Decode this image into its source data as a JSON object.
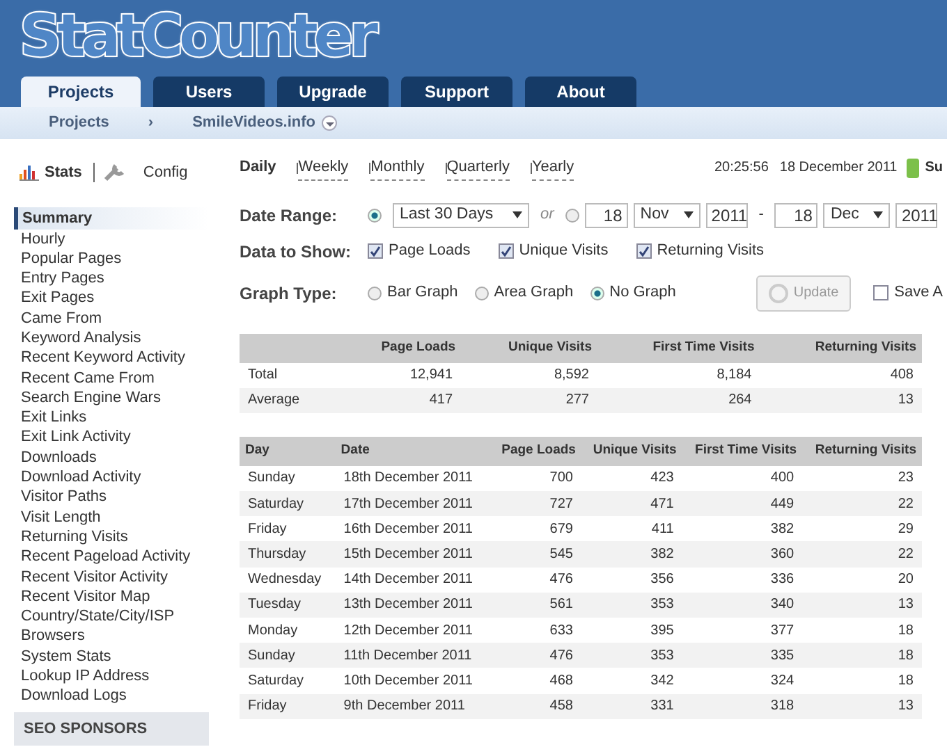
{
  "logo": {
    "text": "StatCounter"
  },
  "tabs": [
    {
      "label": "Projects",
      "selected": true
    },
    {
      "label": "Users",
      "selected": false
    },
    {
      "label": "Upgrade",
      "selected": false
    },
    {
      "label": "Support",
      "selected": false
    },
    {
      "label": "About",
      "selected": false
    }
  ],
  "breadcrumb": {
    "items": [
      "Projects",
      "SmileVideos.info"
    ],
    "separator": "›"
  },
  "sidebar": {
    "modes": [
      {
        "label": "Stats",
        "selected": true
      },
      {
        "label": "Config",
        "selected": false
      }
    ],
    "items": [
      {
        "label": "Summary",
        "selected": true
      },
      {
        "label": "Hourly",
        "selected": false
      },
      {
        "label": "Popular Pages",
        "selected": false
      },
      {
        "label": "Entry Pages",
        "selected": false
      },
      {
        "label": "Exit Pages",
        "selected": false
      },
      {
        "label": "Came From",
        "selected": false
      },
      {
        "label": "Keyword Analysis",
        "selected": false
      },
      {
        "label": "Recent Keyword Activity",
        "selected": false
      },
      {
        "label": "Recent Came From",
        "selected": false
      },
      {
        "label": "Search Engine Wars",
        "selected": false
      },
      {
        "label": "Exit Links",
        "selected": false
      },
      {
        "label": "Exit Link Activity",
        "selected": false
      },
      {
        "label": "Downloads",
        "selected": false
      },
      {
        "label": "Download Activity",
        "selected": false
      },
      {
        "label": "Visitor Paths",
        "selected": false
      },
      {
        "label": "Visit Length",
        "selected": false
      },
      {
        "label": "Returning Visits",
        "selected": false
      },
      {
        "label": "Recent Pageload Activity",
        "selected": false
      },
      {
        "label": "Recent Visitor Activity",
        "selected": false
      },
      {
        "label": "Recent Visitor Map",
        "selected": false
      },
      {
        "label": "Country/State/City/ISP",
        "selected": false
      },
      {
        "label": "Browsers",
        "selected": false
      },
      {
        "label": "System Stats",
        "selected": false
      },
      {
        "label": "Lookup IP Address",
        "selected": false
      },
      {
        "label": "Download Logs",
        "selected": false
      }
    ],
    "sponsors_heading": "SEO SPONSORS"
  },
  "periods": [
    {
      "label": "Daily",
      "selected": true
    },
    {
      "label": "Weekly",
      "selected": false
    },
    {
      "label": "Monthly",
      "selected": false
    },
    {
      "label": "Quarterly",
      "selected": false
    },
    {
      "label": "Yearly",
      "selected": false
    }
  ],
  "clock": {
    "time": "20:25:56",
    "date": "18 December 2011",
    "status": "Su"
  },
  "date_range": {
    "label": "Date Range:",
    "preset_selected": true,
    "preset": "Last 30 Days",
    "or": "or",
    "custom_selected": false,
    "from": {
      "day": "18",
      "month": "Nov",
      "year": "2011"
    },
    "dash": "-",
    "to": {
      "day": "18",
      "month": "Dec",
      "year": "2011"
    }
  },
  "data_to_show": {
    "label": "Data to Show:",
    "options": [
      {
        "label": "Page Loads",
        "checked": true
      },
      {
        "label": "Unique Visits",
        "checked": true
      },
      {
        "label": "Returning Visits",
        "checked": true
      }
    ]
  },
  "graph_type": {
    "label": "Graph Type:",
    "options": [
      {
        "label": "Bar Graph",
        "selected": false
      },
      {
        "label": "Area Graph",
        "selected": false
      },
      {
        "label": "No Graph",
        "selected": true
      }
    ]
  },
  "update_button": {
    "label": "Update",
    "disabled": true
  },
  "save_option": {
    "label": "Save A",
    "checked": false
  },
  "totals_table": {
    "columns": [
      "",
      "Page Loads",
      "Unique Visits",
      "First Time Visits",
      "Returning Visits"
    ],
    "rows": [
      [
        "Total",
        "12,941",
        "8,592",
        "8,184",
        "408"
      ],
      [
        "Average",
        "417",
        "277",
        "264",
        "13"
      ]
    ]
  },
  "daily_table": {
    "columns": [
      "Day",
      "Date",
      "Page Loads",
      "Unique Visits",
      "First Time Visits",
      "Returning Visits"
    ],
    "rows": [
      [
        "Sunday",
        "18th December 2011",
        "700",
        "423",
        "400",
        "23"
      ],
      [
        "Saturday",
        "17th December 2011",
        "727",
        "471",
        "449",
        "22"
      ],
      [
        "Friday",
        "16th December 2011",
        "679",
        "411",
        "382",
        "29"
      ],
      [
        "Thursday",
        "15th December 2011",
        "545",
        "382",
        "360",
        "22"
      ],
      [
        "Wednesday",
        "14th December 2011",
        "476",
        "356",
        "336",
        "20"
      ],
      [
        "Tuesday",
        "13th December 2011",
        "561",
        "353",
        "340",
        "13"
      ],
      [
        "Monday",
        "12th December 2011",
        "633",
        "395",
        "377",
        "18"
      ],
      [
        "Sunday",
        "11th December 2011",
        "476",
        "353",
        "335",
        "18"
      ],
      [
        "Saturday",
        "10th December 2011",
        "468",
        "342",
        "324",
        "18"
      ],
      [
        "Friday",
        "9th December 2011",
        "458",
        "331",
        "318",
        "13"
      ]
    ]
  }
}
